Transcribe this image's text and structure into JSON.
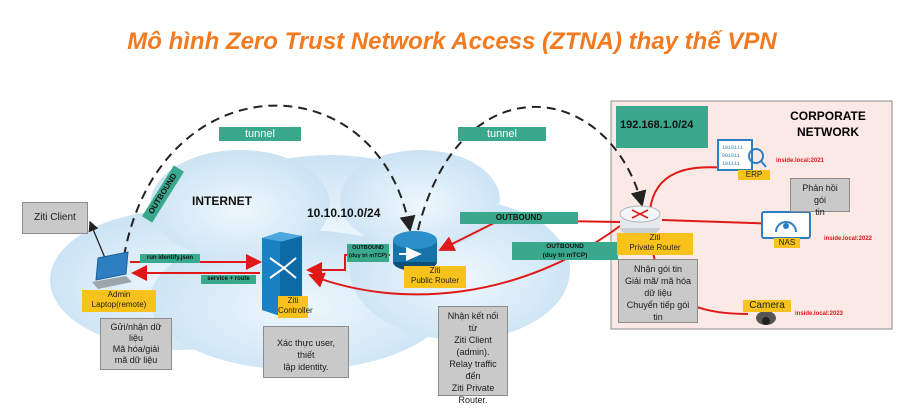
{
  "title": "Mô hình Zero Trust Network Access (ZTNA) thay thế VPN",
  "internet_label": "INTERNET",
  "corporate": {
    "title": "CORPORATE\nNETWORK",
    "subnet": "192.168.1.0/24"
  },
  "public_subnet": "10.10.10.0/24",
  "tunnels": [
    "tunnel",
    "tunnel"
  ],
  "ziti_client": "Ziti Client",
  "admin_label": "Admin\nLaptop(remote)",
  "admin_outbound": "OUTBOUND",
  "run_identity": "run identify.json",
  "service_route": "service + route",
  "controller_label": "Ziti\nController",
  "public_router_outbound": "OUTBOUND\n(duy trì mTCP)",
  "public_router_label": "Ziti\nPublic Router",
  "outbound_bar": "OUTBOUND",
  "private_outbound": "OUTBOUND\n(duy trì mTCP)",
  "private_router_label": "Ziti\nPrivate Router",
  "erp": {
    "label": "ERP",
    "address": "inside.local:2021",
    "icon_text": "1010111\n001011\n101111"
  },
  "nas": {
    "label": "NAS",
    "address": "inside.local:2022"
  },
  "camera": {
    "label": "Camera",
    "address": "inside.local:2023"
  },
  "notes": {
    "admin": "Gửi/nhận dữ\nliệu\nMã hóa/giải\nmã dữ liệu",
    "controller": "Xác thực user, thiết\nlập identity.",
    "public_router": "Nhận kết nối từ\nZiti Client\n(admin).\nRelay traffic đến\nZiti Private\nRouter.",
    "private_router": "Nhận gói tin\nGiải mã/ mã hóa\ndữ liệu\nChuyển tiếp gói\ntin",
    "nas_response": "Phản hồi gói\ntin"
  },
  "colors": {
    "title": "#f27a1f",
    "teal": "#3aa88c",
    "yellow": "#f7c21c",
    "red": "#e01818",
    "corp_bg": "#fbe9e6",
    "cloud": "#d7eaf7"
  }
}
